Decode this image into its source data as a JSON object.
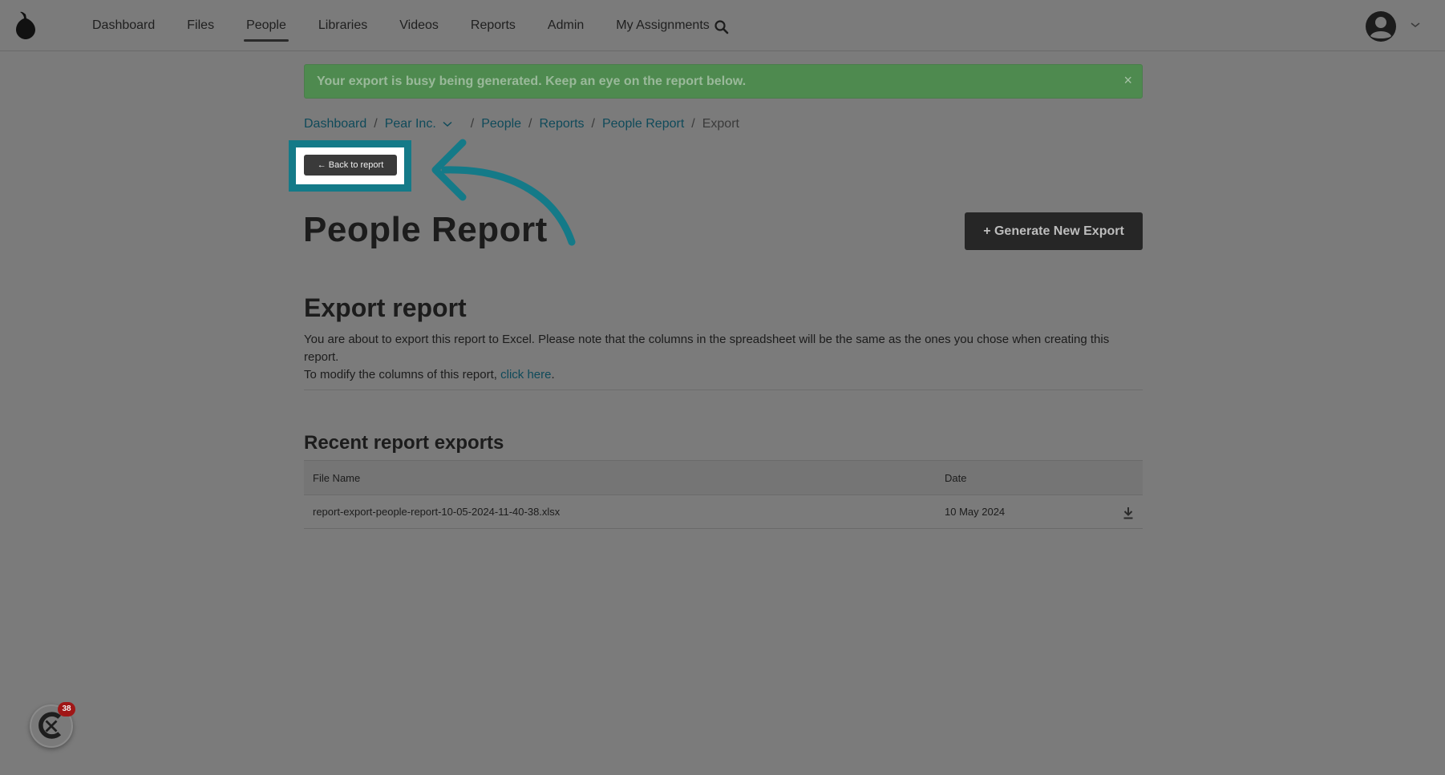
{
  "nav": {
    "items": [
      {
        "label": "Dashboard"
      },
      {
        "label": "Files"
      },
      {
        "label": "People",
        "active": true
      },
      {
        "label": "Libraries"
      },
      {
        "label": "Videos"
      },
      {
        "label": "Reports"
      },
      {
        "label": "Admin"
      },
      {
        "label": "My Assignments"
      }
    ],
    "search_icon": "search-icon",
    "avatar_icon": "user-avatar-icon",
    "caret_icon": "chevron-down-icon"
  },
  "alert": {
    "message": "Your export is busy being generated. Keep an eye on the report below.",
    "close": "×"
  },
  "breadcrumb": {
    "items": [
      "Dashboard",
      "Pear Inc.",
      "People",
      "Reports",
      "People Report"
    ],
    "current": "Export",
    "separator": "/"
  },
  "back_button": {
    "label": "← Back to report"
  },
  "page": {
    "title": "People Report",
    "generate_button": "+ Generate New Export"
  },
  "export_section": {
    "title": "Export report",
    "desc_1": "You are about to export this report to Excel. Please note that the columns in the spreadsheet will be the same as the ones you chose when creating this report.",
    "desc_2": "To modify the columns of this report, ",
    "link": "click here",
    "desc_end": "."
  },
  "recent": {
    "title": "Recent report exports",
    "columns": [
      "File Name",
      "Date"
    ],
    "rows": [
      {
        "file": "report-export-people-report-10-05-2024-11-40-38.xlsx",
        "date": "10 May 2024"
      }
    ]
  },
  "widget": {
    "badge": "38"
  },
  "colors": {
    "alert_bg": "#4e8a4f",
    "highlight": "#147a88",
    "link": "#0f4a5a"
  }
}
